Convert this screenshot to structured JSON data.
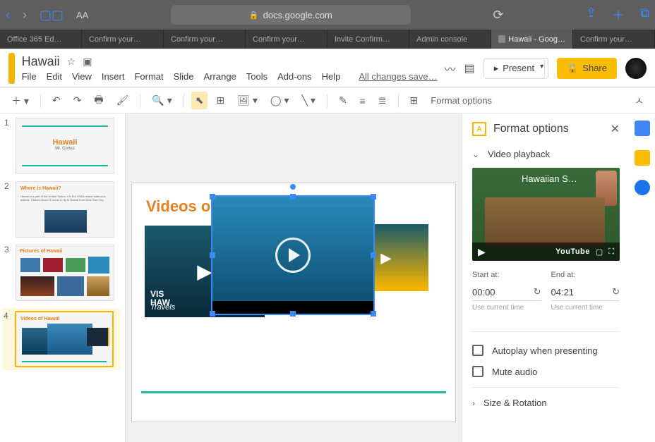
{
  "browser": {
    "url": "docs.google.com",
    "font_controls": "AA"
  },
  "tabs": [
    {
      "label": "Office 365 Ed…"
    },
    {
      "label": "Confirm your…"
    },
    {
      "label": "Confirm your…"
    },
    {
      "label": "Confirm your…"
    },
    {
      "label": "Invite Confirm…"
    },
    {
      "label": "Admin console"
    },
    {
      "label": "Hawaii - Goog…",
      "active": true
    },
    {
      "label": "Confirm your…"
    }
  ],
  "doc": {
    "title": "Hawaii",
    "saved_text": "All changes save…"
  },
  "menus": [
    "File",
    "Edit",
    "View",
    "Insert",
    "Format",
    "Slide",
    "Arrange",
    "Tools",
    "Add-ons",
    "Help"
  ],
  "header_buttons": {
    "present": "Present",
    "share": "Share"
  },
  "toolbar": {
    "format_options": "Format options"
  },
  "thumbnails": [
    {
      "num": "1",
      "title": "Hawaii",
      "subtitle": "Mr. Cortez"
    },
    {
      "num": "2",
      "title": "Where is Hawaii?"
    },
    {
      "num": "3",
      "title": "Pictures of Hawaii"
    },
    {
      "num": "4",
      "title": "Videos of Hawaii",
      "active": true
    }
  ],
  "slide": {
    "title": "Videos of Hawaii",
    "video1_overlay1": "VIS",
    "video1_overlay2": "HAW",
    "video1_caption": "Travels"
  },
  "panel": {
    "title": "Format options",
    "video_playback": "Video playback",
    "preview_title": "Hawaiian S…",
    "youtube": "YouTube",
    "start_label": "Start at:",
    "end_label": "End at:",
    "start_value": "00:00",
    "end_value": "04:21",
    "use_current": "Use current time",
    "autoplay": "Autoplay when presenting",
    "mute": "Mute audio",
    "size_rotation": "Size & Rotation"
  }
}
